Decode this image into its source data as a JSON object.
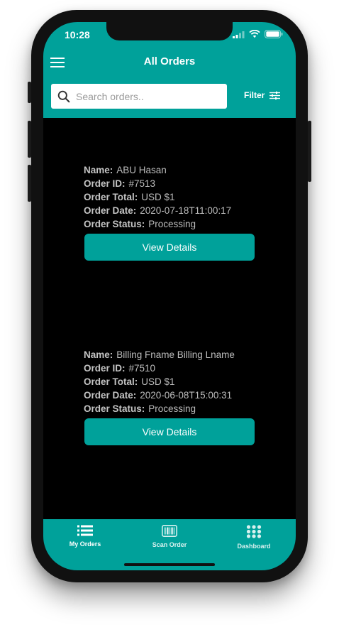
{
  "status_bar": {
    "time": "10:28"
  },
  "header": {
    "title": "All Orders"
  },
  "search": {
    "placeholder": "Search orders.."
  },
  "filter": {
    "label": "Filter"
  },
  "orders": [
    {
      "name_label": "Name:",
      "name": "ABU Hasan",
      "id_label": "Order ID:",
      "id": "#7513",
      "total_label": "Order Total:",
      "total": "USD $1",
      "date_label": "Order Date:",
      "date": "2020-07-18T11:00:17",
      "status_label": "Order Status:",
      "status": "Processing",
      "button_label": "View Details"
    },
    {
      "name_label": "Name:",
      "name": "Billing Fname Billing Lname",
      "id_label": "Order ID:",
      "id": "#7510",
      "total_label": "Order Total:",
      "total": "USD $1",
      "date_label": "Order Date:",
      "date": "2020-06-08T15:00:31",
      "status_label": "Order Status:",
      "status": "Processing",
      "button_label": "View Details"
    }
  ],
  "tabs": [
    {
      "label": "My Orders",
      "icon": "list-icon",
      "active": true
    },
    {
      "label": "Scan Order",
      "icon": "barcode-icon",
      "active": false
    },
    {
      "label": "Dashboard",
      "icon": "grid-icon",
      "active": false
    }
  ],
  "colors": {
    "accent": "#00a19a",
    "background": "#000000",
    "text_muted": "#bdbdbd"
  }
}
